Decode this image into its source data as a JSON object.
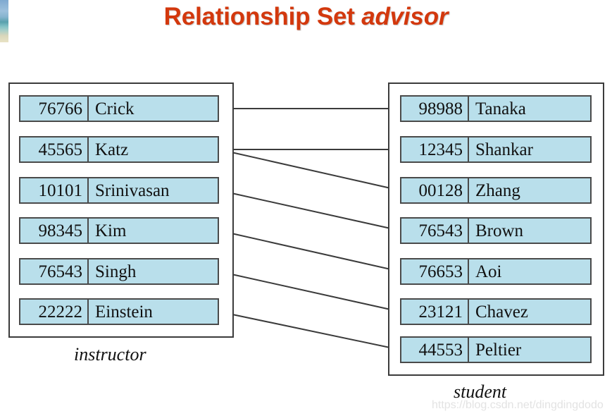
{
  "slide": {
    "title_prefix": "Relationship Set ",
    "title_emphasis": "advisor",
    "title_color": "#d3380d",
    "background_color": "#ffffff",
    "watermark": "https://blog.csdn.net/dingdingdodo"
  },
  "style": {
    "cell_fill": "#b9dfeb",
    "cell_border": "#4a4a4a",
    "frame_border": "#3b3b3b",
    "link_color": "#3b3b3b"
  },
  "instructor": {
    "caption": "instructor",
    "rows": [
      {
        "id": "76766",
        "name": "Crick"
      },
      {
        "id": "45565",
        "name": "Katz"
      },
      {
        "id": "10101",
        "name": "Srinivasan"
      },
      {
        "id": "98345",
        "name": "Kim"
      },
      {
        "id": "76543",
        "name": "Singh"
      },
      {
        "id": "22222",
        "name": "Einstein"
      }
    ]
  },
  "student": {
    "caption": "student",
    "rows": [
      {
        "id": "98988",
        "name": "Tanaka"
      },
      {
        "id": "12345",
        "name": "Shankar"
      },
      {
        "id": "00128",
        "name": "Zhang"
      },
      {
        "id": "76543",
        "name": "Brown"
      },
      {
        "id": "76653",
        "name": "Aoi"
      },
      {
        "id": "23121",
        "name": "Chavez"
      },
      {
        "id": "44553",
        "name": "Peltier"
      }
    ]
  },
  "relationships": [
    {
      "instructor": "76766",
      "instructor_name": "Crick",
      "student": "98988",
      "student_name": "Tanaka"
    },
    {
      "instructor": "45565",
      "instructor_name": "Katz",
      "student": "12345",
      "student_name": "Shankar"
    },
    {
      "instructor": "45565",
      "instructor_name": "Katz",
      "student": "00128",
      "student_name": "Zhang"
    },
    {
      "instructor": "10101",
      "instructor_name": "Srinivasan",
      "student": "76543",
      "student_name": "Brown"
    },
    {
      "instructor": "98345",
      "instructor_name": "Kim",
      "student": "76653",
      "student_name": "Aoi"
    },
    {
      "instructor": "76543",
      "instructor_name": "Singh",
      "student": "23121",
      "student_name": "Chavez"
    },
    {
      "instructor": "22222",
      "instructor_name": "Einstein",
      "student": "44553",
      "student_name": "Peltier"
    }
  ]
}
